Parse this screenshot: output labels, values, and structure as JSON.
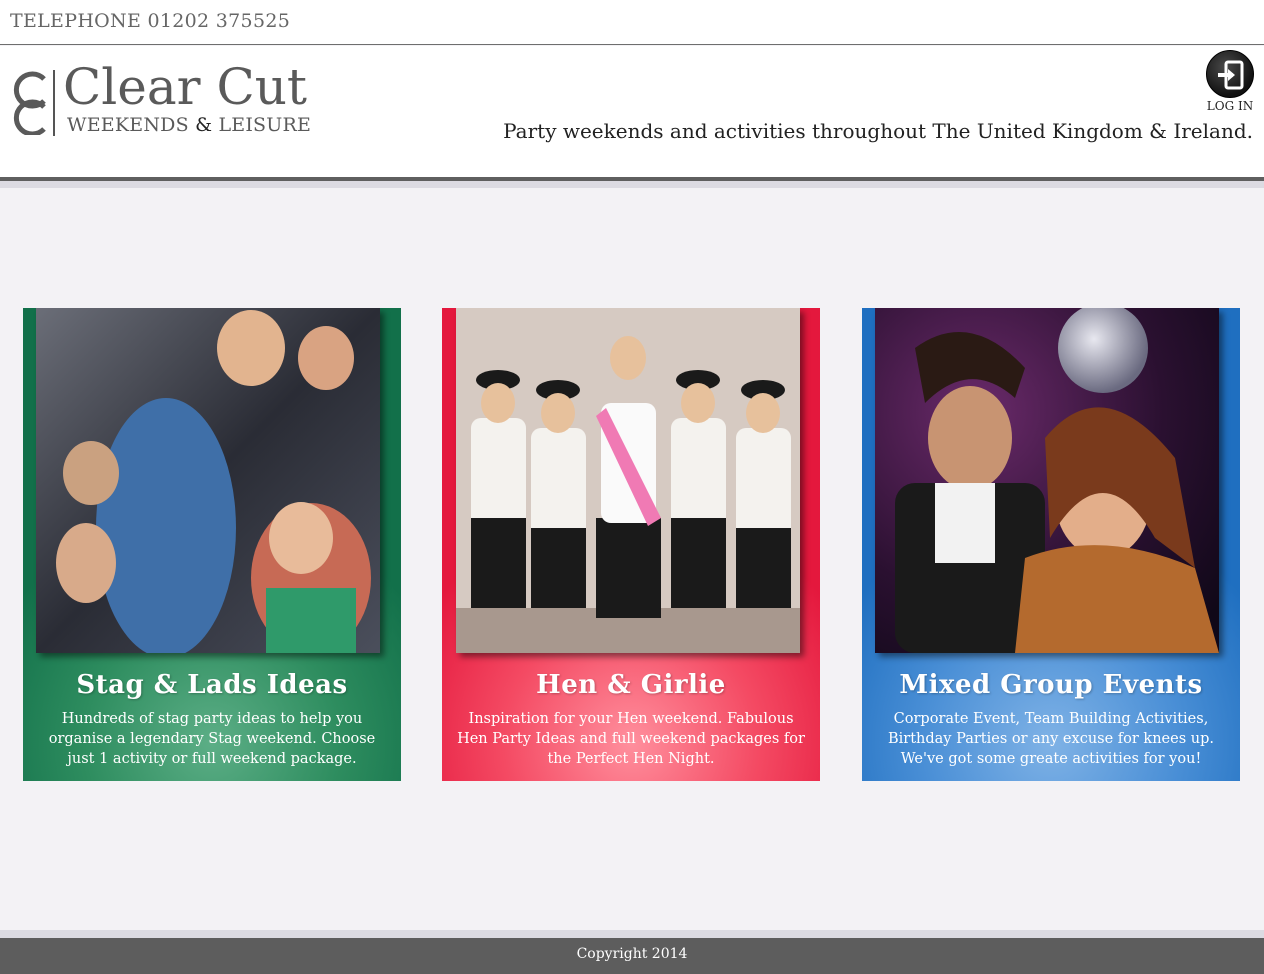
{
  "topbar": {
    "phone": "TELEPHONE 01202 375525"
  },
  "header": {
    "logo_mark": "CC",
    "logo_title": "Clear Cut",
    "logo_sub_a": "WEEKENDS",
    "logo_sub_amp": "&",
    "logo_sub_b": "LEISURE",
    "login_label": "LOG IN",
    "login_icon": "login-arrow-icon",
    "tagline": "Party weekends and activities throughout The United Kingdom & Ireland."
  },
  "cards": [
    {
      "title": "Stag & Lads Ideas",
      "description": "Hundreds of stag party ideas to help you organise a legendary Stag weekend. Choose just 1 activity or full weekend package.",
      "color": "#12704a"
    },
    {
      "title": "Hen & Girlie",
      "description": "Inspiration for your Hen weekend. Fabulous Hen Party Ideas and full weekend packages for the Perfect Hen Night.",
      "color": "#e4183d"
    },
    {
      "title": "Mixed Group Events",
      "description": "Corporate Event, Team Building Activities, Birthday Parties or any excuse for knees up. We've got some greate activities for you!",
      "color": "#1f6fc0"
    }
  ],
  "footer": {
    "copyright": "Copyright 2014"
  }
}
